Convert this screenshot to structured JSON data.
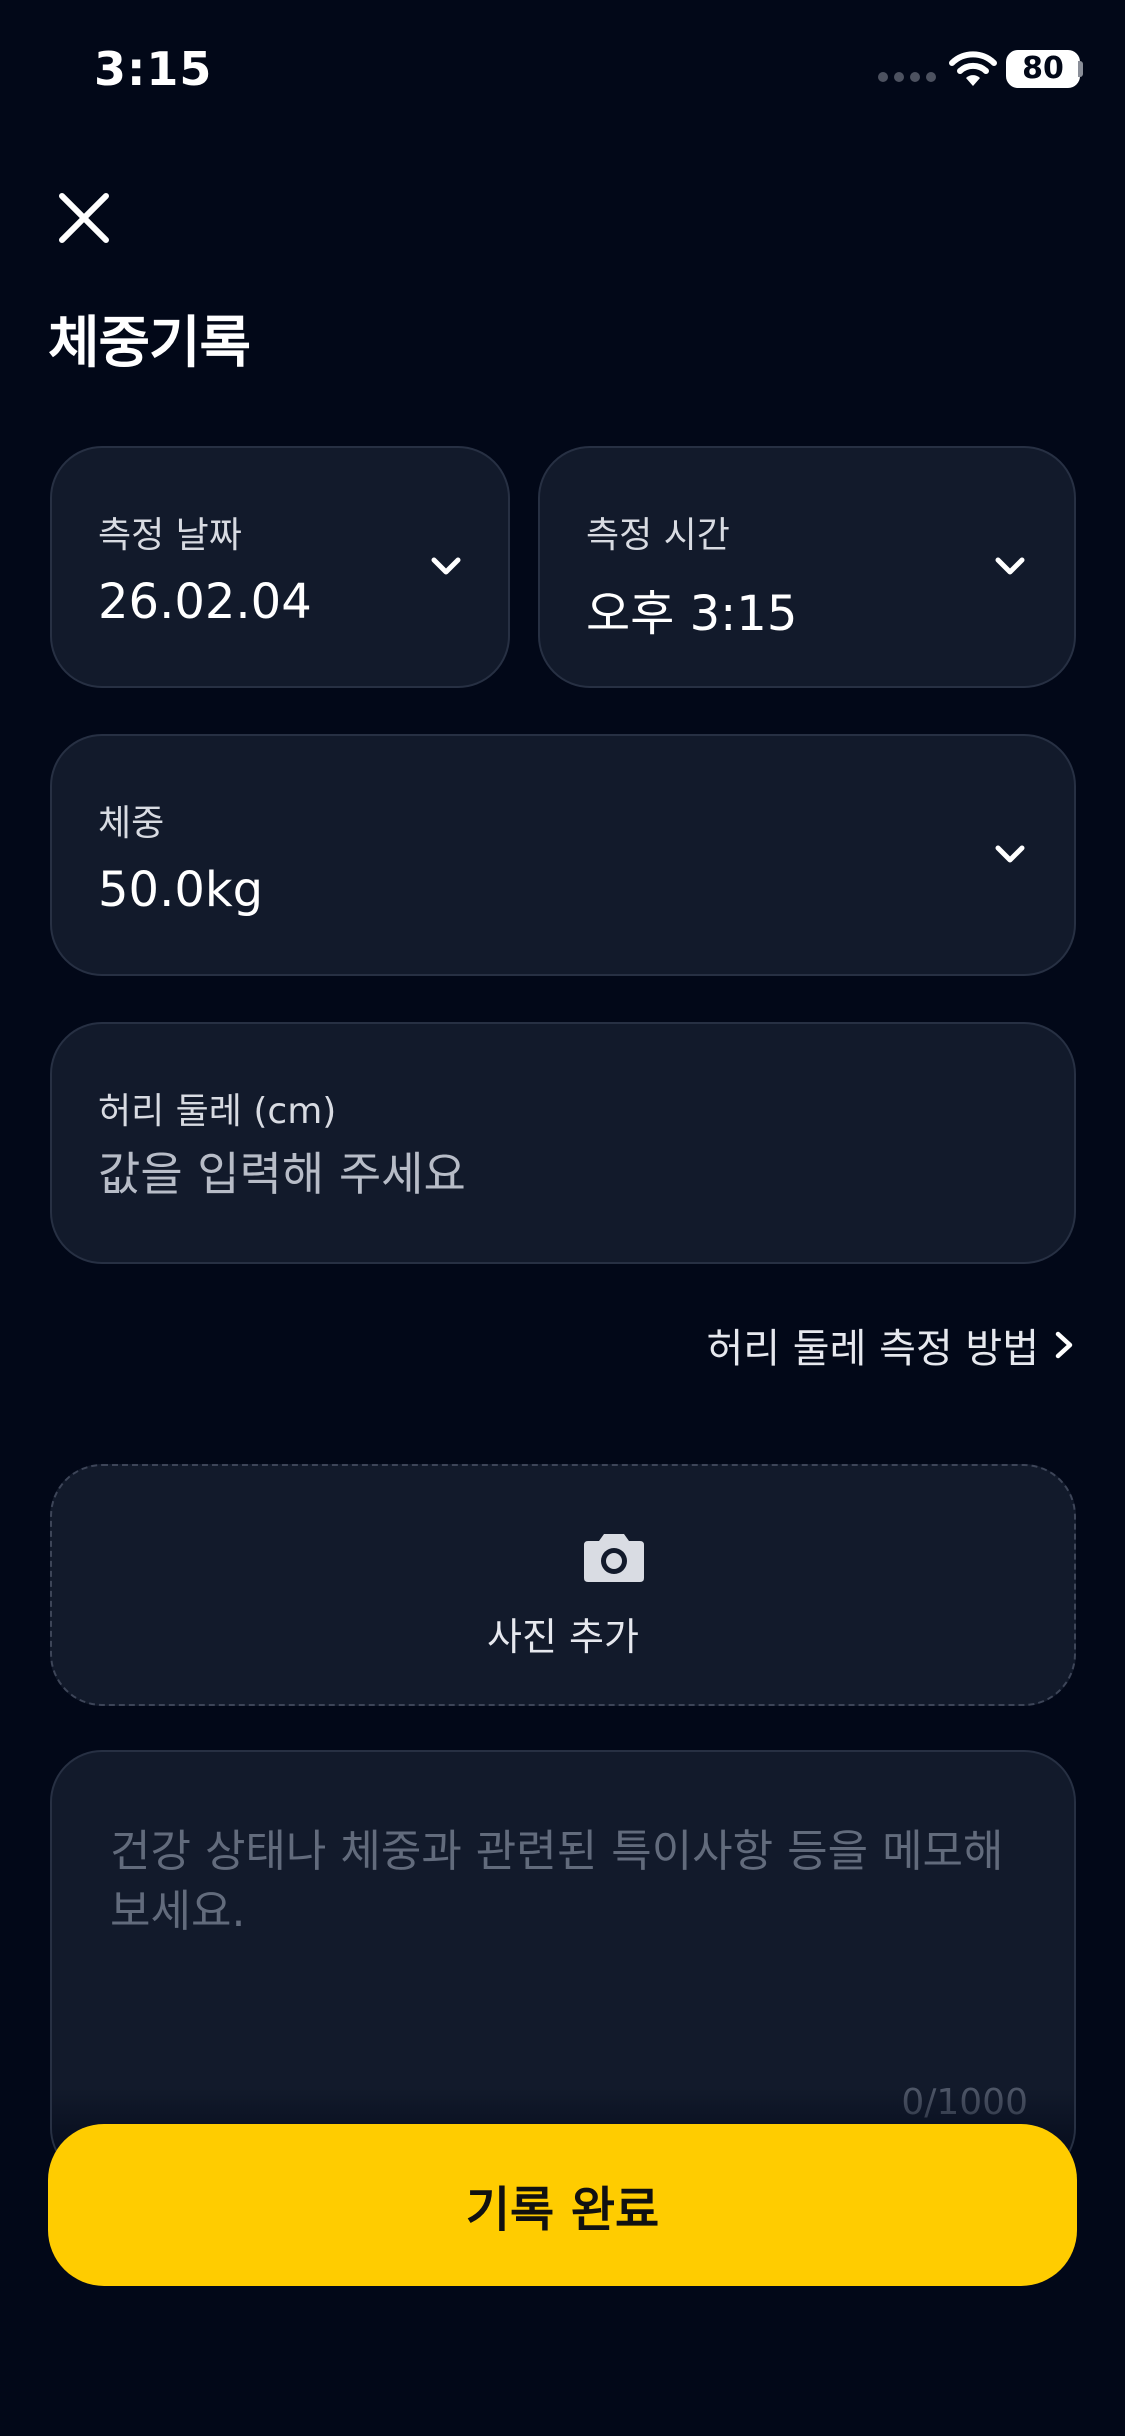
{
  "status_bar": {
    "time": "3:15",
    "battery_level": "80",
    "icons": [
      "signal-dots-icon",
      "wifi-icon",
      "battery-icon"
    ]
  },
  "header": {
    "close_icon": "close-icon",
    "title": "체중기록"
  },
  "date_field": {
    "label": "측정 날짜",
    "value": "26.02.04",
    "icon": "chevron-down-icon"
  },
  "time_field": {
    "label": "측정 시간",
    "value": "오후 3:15",
    "icon": "chevron-down-icon"
  },
  "weight_field": {
    "label": "체중",
    "value": "50.0kg",
    "icon": "chevron-down-icon"
  },
  "waist_field": {
    "label": "허리 둘레 (cm)",
    "value": "",
    "placeholder": "값을 입력해 주세요"
  },
  "waist_link": {
    "label": "허리 둘레 측정 방법",
    "icon": "chevron-right-icon"
  },
  "photo": {
    "icon": "camera-icon",
    "label": "사진 추가"
  },
  "memo": {
    "value": "",
    "placeholder": "건강 상태나 체중과 관련된 특이사항 등을 메모해 보세요.",
    "count": "0/1000"
  },
  "submit": {
    "label": "기록 완료"
  },
  "colors": {
    "background": "#020818",
    "card": "#121a2b",
    "accent": "#ffcc00"
  }
}
